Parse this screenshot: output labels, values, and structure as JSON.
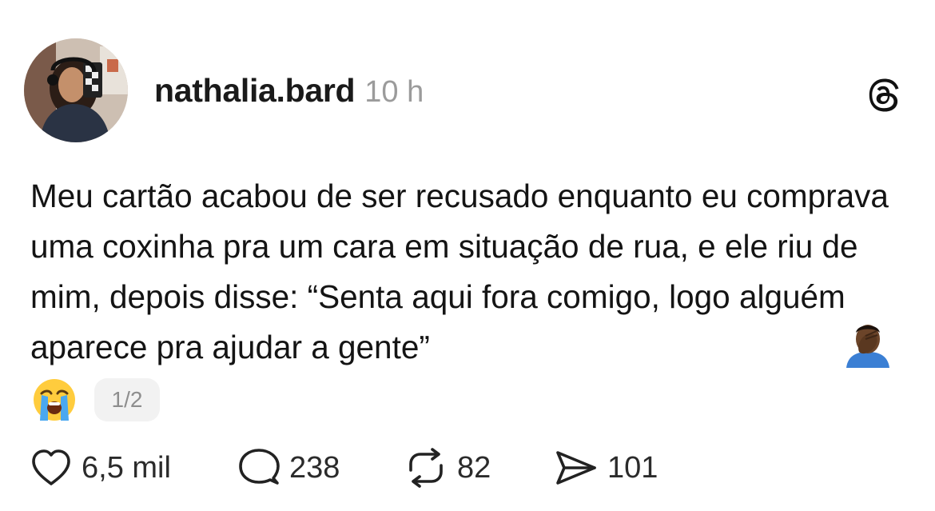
{
  "post": {
    "username": "nathalia.bard",
    "timestamp": "10 h",
    "text": "Meu cartão acabou de ser recusado enquanto eu comprava uma coxinha pra um cara em situação de rua, e ele riu de mim, depois disse: “Senta aqui fora comigo, logo alguém aparece pra ajudar a gente”",
    "emojis": [
      "facepalm-emoji",
      "loudly-crying-face-emoji"
    ],
    "page_indicator": "1/2"
  },
  "actions": {
    "likes": "6,5 mil",
    "comments": "238",
    "reposts": "82",
    "shares": "101"
  },
  "icons": {
    "brand": "threads-logo-icon",
    "like": "heart-icon",
    "comment": "speech-bubble-icon",
    "repost": "repost-icon",
    "share": "paper-plane-icon"
  },
  "colors": {
    "text": "#141414",
    "muted": "#9b9b9b",
    "indicator_bg": "#f2f2f2"
  }
}
